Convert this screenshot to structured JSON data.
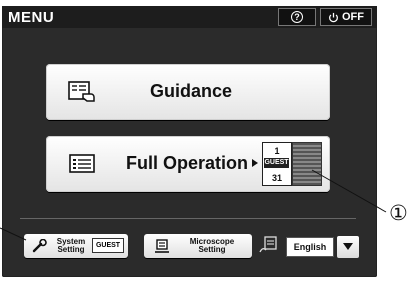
{
  "header": {
    "title": "MENU",
    "help_label": "?",
    "off_label": "OFF"
  },
  "main": {
    "guidance_label": "Guidance",
    "full_operation_label": "Full Operation",
    "user_indicator": {
      "top_number": "1",
      "user": "GUEST",
      "bottom_number": "31"
    }
  },
  "footer": {
    "system_setting_label": [
      "System",
      "Setting"
    ],
    "system_setting_user": "GUEST",
    "microscope_setting_label": [
      "Microscope",
      "Setting"
    ],
    "language_value": "English"
  },
  "annotation": {
    "callout": "①"
  },
  "icons": [
    "help-icon",
    "power-icon",
    "guide-book-icon",
    "list-icon",
    "wrench-icon",
    "microscope-icon",
    "note-language-icon",
    "dropdown-arrow-icon"
  ],
  "colors": {
    "screen_bg": "#2b2b2b",
    "topbar_bg": "#1d1d1d",
    "button_face": "#f0f0f0"
  }
}
